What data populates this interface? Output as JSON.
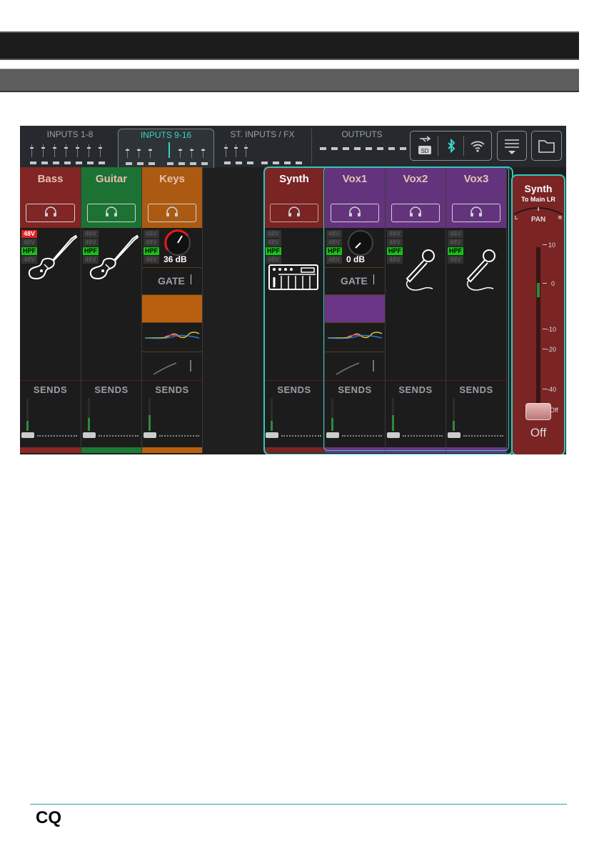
{
  "tabs": [
    {
      "label": "INPUTS 1-8"
    },
    {
      "label": "INPUTS 9-16"
    },
    {
      "label": "ST. INPUTS / FX"
    },
    {
      "label": "OUTPUTS"
    }
  ],
  "channels": [
    {
      "name": "Bass",
      "color": "#8a2626",
      "icon": "bass-guitar-icon",
      "badges": [
        "48V",
        "48V",
        "HPF",
        "48V"
      ],
      "gain": ""
    },
    {
      "name": "Guitar",
      "color": "#1c7a35",
      "icon": "electric-guitar-icon",
      "badges": [
        "48V",
        "48V",
        "HPF",
        "48V"
      ],
      "gain": ""
    },
    {
      "name": "Keys",
      "color": "#b86010",
      "icon": "knob-icon",
      "badges": [
        "48V",
        "48V",
        "HPF",
        "48V"
      ],
      "gain": "36 dB",
      "gate": "GATE"
    },
    {
      "name": "Synth",
      "color": "#8a2626",
      "icon": "keyboard-icon",
      "badges": [
        "48V",
        "48V",
        "HPF",
        "48V"
      ],
      "gain": ""
    },
    {
      "name": "Vox1",
      "color": "#6a3585",
      "icon": "knob-icon",
      "badges": [
        "48V",
        "48V",
        "HPF",
        "48V"
      ],
      "gain": "0 dB",
      "gate": "GATE"
    },
    {
      "name": "Vox2",
      "color": "#6a3585",
      "icon": "microphone-icon",
      "badges": [
        "48V",
        "48V",
        "HPF",
        "48V"
      ],
      "gain": ""
    },
    {
      "name": "Vox3",
      "color": "#6a3585",
      "icon": "microphone-icon",
      "badges": [
        "48V",
        "48V",
        "HPF",
        "48V"
      ],
      "gain": ""
    }
  ],
  "sends_label": "SENDS",
  "master": {
    "name": "Synth",
    "dest": "To Main LR",
    "pan_label": "PAN",
    "pan_l": "L",
    "pan_r": "R",
    "scale": [
      "10",
      "0",
      "-10",
      "-20",
      "-40",
      "Off"
    ],
    "value": "Off"
  },
  "footer": {
    "logo": "CQ"
  }
}
